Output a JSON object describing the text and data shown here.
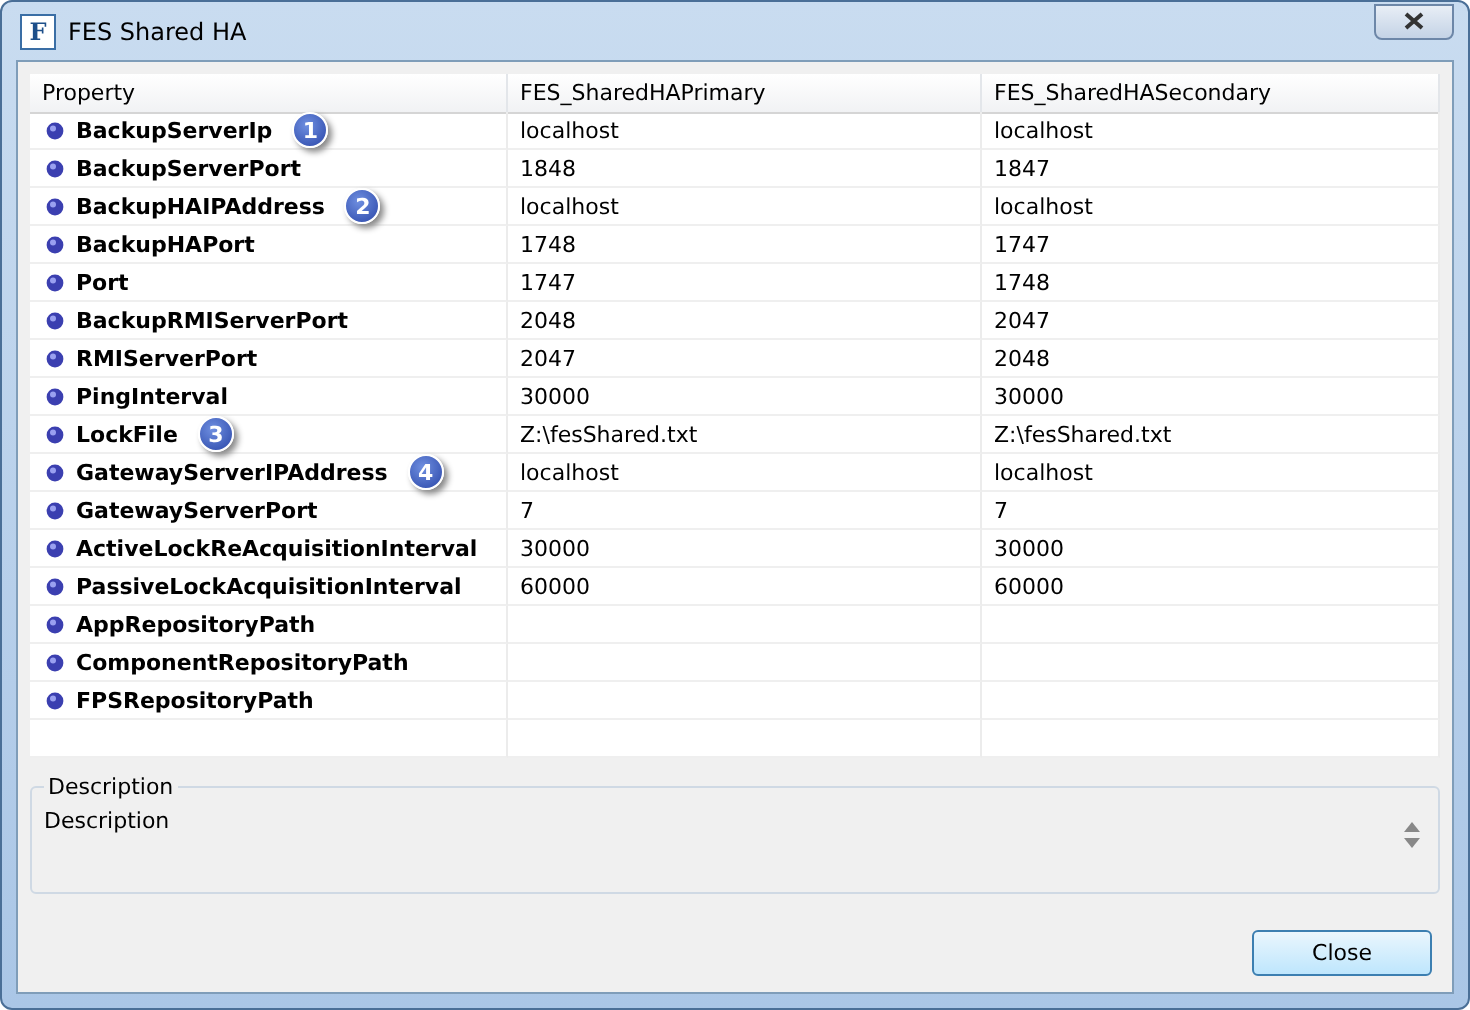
{
  "window": {
    "title": "FES Shared HA",
    "app_icon": "F"
  },
  "table": {
    "columns": [
      "Property",
      "FES_SharedHAPrimary",
      "FES_SharedHASecondary"
    ],
    "rows": [
      {
        "property": {
          "name": "BackupServerIp",
          "callout": "1"
        },
        "primary": "localhost",
        "secondary": "localhost"
      },
      {
        "property": {
          "name": "BackupServerPort"
        },
        "primary": "1848",
        "secondary": "1847"
      },
      {
        "property": {
          "name": "BackupHAIPAddress",
          "callout": "2"
        },
        "primary": "localhost",
        "secondary": "localhost"
      },
      {
        "property": {
          "name": "BackupHAPort"
        },
        "primary": "1748",
        "secondary": "1747"
      },
      {
        "property": {
          "name": "Port"
        },
        "primary": "1747",
        "secondary": "1748"
      },
      {
        "property": {
          "name": "BackupRMIServerPort"
        },
        "primary": "2048",
        "secondary": "2047"
      },
      {
        "property": {
          "name": "RMIServerPort"
        },
        "primary": "2047",
        "secondary": "2048"
      },
      {
        "property": {
          "name": "PingInterval"
        },
        "primary": "30000",
        "secondary": "30000"
      },
      {
        "property": {
          "name": "LockFile",
          "callout": "3"
        },
        "primary": "Z:\\fesShared.txt",
        "secondary": "Z:\\fesShared.txt"
      },
      {
        "property": {
          "name": "GatewayServerIPAddress",
          "callout": "4"
        },
        "primary": "localhost",
        "secondary": "localhost"
      },
      {
        "property": {
          "name": "GatewayServerPort"
        },
        "primary": "7",
        "secondary": "7"
      },
      {
        "property": {
          "name": "ActiveLockReAcquisitionInterval"
        },
        "primary": "30000",
        "secondary": "30000"
      },
      {
        "property": {
          "name": "PassiveLockAcquisitionInterval"
        },
        "primary": "60000",
        "secondary": "60000"
      },
      {
        "property": {
          "name": "AppRepositoryPath"
        }
      },
      {
        "property": {
          "name": "ComponentRepositoryPath"
        }
      },
      {
        "property": {
          "name": "FPSRepositoryPath"
        }
      }
    ]
  },
  "description": {
    "legend": "Description",
    "text": "Description"
  },
  "buttons": [
    "Close"
  ]
}
